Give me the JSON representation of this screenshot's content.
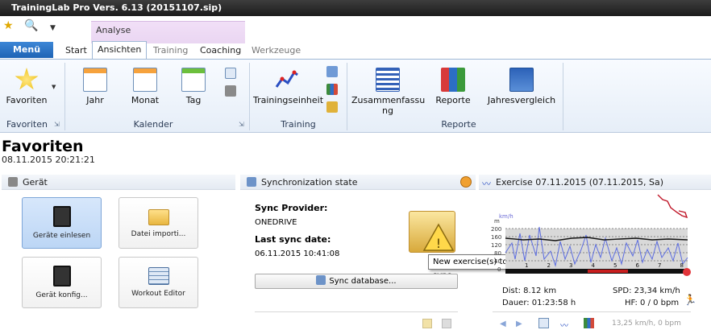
{
  "app": {
    "title": "TrainingLab Pro Vers. 6.13 (20151107.sip)"
  },
  "context_tab": {
    "label": "Analyse"
  },
  "tabs": {
    "menu": "Menü",
    "start": "Start",
    "ansichten": "Ansichten",
    "training": "Training",
    "coaching": "Coaching",
    "werkzeuge": "Werkzeuge"
  },
  "ribbon": {
    "favoriten": {
      "button": "Favoriten",
      "group": "Favoriten"
    },
    "kalender": {
      "jahr": "Jahr",
      "monat": "Monat",
      "tag": "Tag",
      "group": "Kalender"
    },
    "training": {
      "einheit": "Trainingseinheit",
      "group": "Training"
    },
    "reporte": {
      "zusammen_1": "Zusammenfassu",
      "zusammen_2": "ng",
      "reporte": "Reporte",
      "jahresvergleich": "Jahresvergleich",
      "group": "Reporte"
    }
  },
  "page": {
    "title": "Favoriten",
    "date": "08.11.2015 20:21:21"
  },
  "geraet": {
    "header": "Gerät",
    "tiles": {
      "einlesen": "Geräte einlesen",
      "importieren": "Datei importi...",
      "konfig": "Gerät konfig...",
      "workout": "Workout Editor"
    }
  },
  "sync": {
    "header": "Synchronization state",
    "provider_label": "Sync Provider:",
    "provider_value": "ONEDRIVE",
    "last_label": "Last sync date:",
    "last_value": "06.11.2015 10:41:08",
    "button": "Sync database...",
    "tooltip": "New exercise(s) to sync"
  },
  "exercise": {
    "header": "Exercise 07.11.2015 (07.11.2015, Sa)",
    "chart_labels": {
      "kmh": "km/h",
      "m": "m",
      "y200": "200",
      "y160": "160",
      "y120": "120",
      "y80": "80",
      "y40": "40",
      "y0": "0"
    },
    "x_ticks": [
      "1",
      "2",
      "3",
      "4",
      "5",
      "6",
      "7",
      "8"
    ],
    "dist": "Dist: 8.12 km",
    "spd": "SPD: 23,34 km/h",
    "dauer": "Dauer: 01:23:58 h",
    "hf": "HF: 0 / 0 bpm"
  },
  "status": {
    "text": "13,25 km/h, 0 bpm"
  },
  "colors": {
    "ribbon_blue": "#1e63b5",
    "accent_orange": "#f0a030"
  }
}
